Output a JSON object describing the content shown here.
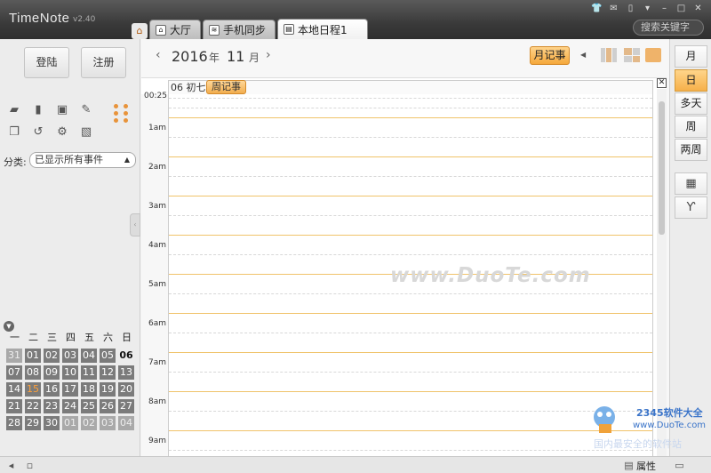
{
  "app": {
    "title": "TimeNote",
    "version": "v2.40"
  },
  "search": {
    "placeholder": "搜索关键字"
  },
  "tabs": [
    {
      "label": "大厅",
      "icon": "home-icon"
    },
    {
      "label": "手机同步",
      "icon": "wifi-phone-icon"
    },
    {
      "label": "本地日程1",
      "icon": "calendar-doc-icon"
    }
  ],
  "auth": {
    "login": "登陆",
    "register": "注册"
  },
  "category": {
    "label": "分类:",
    "value": "已显示所有事件"
  },
  "mini_calendar": {
    "weekdays": [
      "一",
      "二",
      "三",
      "四",
      "五",
      "六",
      "日"
    ],
    "weeks": [
      [
        "31",
        "01",
        "02",
        "03",
        "04",
        "05",
        "06"
      ],
      [
        "07",
        "08",
        "09",
        "10",
        "11",
        "12",
        "13"
      ],
      [
        "14",
        "15",
        "16",
        "17",
        "18",
        "19",
        "20"
      ],
      [
        "21",
        "22",
        "23",
        "24",
        "25",
        "26",
        "27"
      ],
      [
        "28",
        "29",
        "30",
        "01",
        "02",
        "03",
        "04"
      ]
    ]
  },
  "nav": {
    "year": "2016",
    "year_unit": "年",
    "month": "11",
    "month_unit": "月",
    "month_note": "月记事"
  },
  "day": {
    "header": "06 初七",
    "week_note": "周记事"
  },
  "time_labels": [
    "00:25",
    "1am",
    "2am",
    "3am",
    "4am",
    "5am",
    "6am",
    "7am",
    "8am",
    "9am"
  ],
  "views": [
    "月",
    "日",
    "多天",
    "周",
    "两周"
  ],
  "active_view": "日",
  "watermark": "www.DuoTe.com",
  "corner_logo": {
    "brand": "2345软件大全",
    "url": "www.DuoTe.com",
    "faint": "国内最安全的软件站"
  },
  "status": {
    "properties": "属性"
  },
  "colors": {
    "accent": "#f5a83c",
    "titlebar": "#3a3a3a",
    "hour_line": "#f0c36a"
  }
}
